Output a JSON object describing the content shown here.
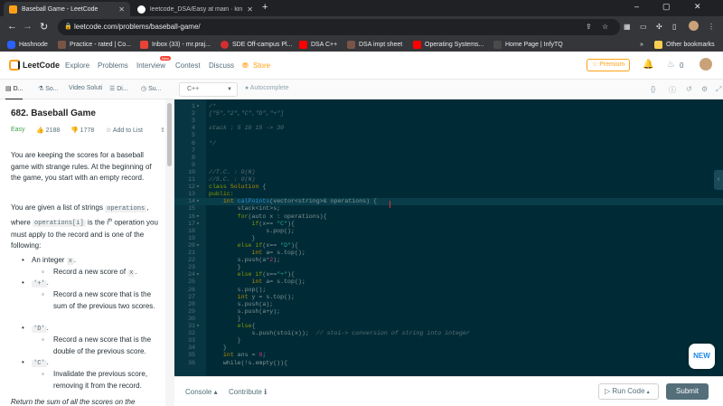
{
  "browser": {
    "tabs": [
      {
        "title": "Baseball Game - LeetCode",
        "active": true
      },
      {
        "title": "leetcode_DSA/Easy at main · kin",
        "active": false
      }
    ],
    "new_tab": "+",
    "window_controls": [
      "–",
      "▢",
      "✕"
    ],
    "url": "leetcode.com/problems/baseball-game/",
    "bookmarks": [
      {
        "label": "Hashnode",
        "color": "#2962ff"
      },
      {
        "label": "Practice - rated | Co...",
        "color": "#795548"
      },
      {
        "label": "Inbox (33) - mr.praj...",
        "color": "#ea4335"
      },
      {
        "label": "SDE Off-campus Pl...",
        "color": "#d32f2f"
      },
      {
        "label": "DSA C++",
        "color": "#ff0000"
      },
      {
        "label": "DSA impt sheet",
        "color": "#795548"
      },
      {
        "label": "Operating Systems...",
        "color": "#ff0000"
      },
      {
        "label": "Home Page | InfyTQ",
        "color": "#4a4a4a"
      }
    ],
    "bookmarks_more": "»",
    "other_bookmarks": "Other bookmarks"
  },
  "lcnav": {
    "logo": "LeetCode",
    "links": [
      "Explore",
      "Problems",
      "Interview",
      "Contest",
      "Discuss",
      "Store"
    ],
    "new_badge": "New",
    "premium": "Premium",
    "notifications_count": "0"
  },
  "left": {
    "tabs": [
      "D...",
      "So...",
      "Video Soluti",
      "Di...",
      "Su..."
    ],
    "title": "682. Baseball Game",
    "difficulty": "Easy",
    "likes": "2188",
    "dislikes": "1778",
    "add_to_list": "Add to List",
    "p1": "You are keeping the scores for a baseball game with strange rules. At the beginning of the game, you start with an empty record.",
    "p2_a": "You are given a list of strings",
    "p2_code1": "operations",
    "p2_b": ", where",
    "p2_code2": "operations[i]",
    "p2_c": "is the",
    "p2_sup": "th",
    "p2_d": "operation you must apply to the record and is one of the following:",
    "items": [
      {
        "head": "An integer",
        "code": "x",
        "desc": "Record a new score of",
        "desc_code": "x"
      },
      {
        "code": "'+'",
        "desc": "Record a new score that is the sum of the previous two scores."
      },
      {
        "code": "'D'",
        "desc": "Record a new score that is the double of the previous score."
      },
      {
        "code": "'C'",
        "desc": "Invalidate the previous score, removing it from the record."
      }
    ],
    "p3": "Return the sum of all the scores on the"
  },
  "editor": {
    "language": "C++",
    "autocomplete": "Autocomplete",
    "lines": [
      {
        "n": "1",
        "fold": "▾",
        "segments": [
          {
            "t": "/*",
            "c": "cm"
          }
        ]
      },
      {
        "n": "2",
        "fold": "",
        "segments": [
          {
            "t": "[\"5\",\"2\",\"C\",\"D\",\"+\"]",
            "c": "cm"
          }
        ]
      },
      {
        "n": "3",
        "fold": "",
        "segments": []
      },
      {
        "n": "4",
        "fold": "",
        "segments": [
          {
            "t": "stack : 5 10 15 -> 30",
            "c": "cm"
          }
        ]
      },
      {
        "n": "5",
        "fold": "",
        "segments": []
      },
      {
        "n": "6",
        "fold": "",
        "segments": [
          {
            "t": "*/",
            "c": "cm"
          }
        ]
      },
      {
        "n": "7",
        "fold": "",
        "segments": []
      },
      {
        "n": "8",
        "fold": "",
        "segments": []
      },
      {
        "n": "9",
        "fold": "",
        "segments": []
      },
      {
        "n": "10",
        "fold": "",
        "segments": [
          {
            "t": "//T.C. : O(N)",
            "c": "cm"
          }
        ]
      },
      {
        "n": "11",
        "fold": "",
        "segments": [
          {
            "t": "//S.C. : O(N)",
            "c": "cm"
          }
        ]
      },
      {
        "n": "12",
        "fold": "▾",
        "segments": [
          {
            "t": "class ",
            "c": "kw"
          },
          {
            "t": "Solution",
            "c": "ty"
          },
          {
            "t": " {",
            "c": "pl"
          }
        ]
      },
      {
        "n": "13",
        "fold": "",
        "segments": [
          {
            "t": "public:",
            "c": "kw"
          }
        ]
      },
      {
        "n": "14",
        "fold": "▾",
        "segments": [
          {
            "t": "    int ",
            "c": "ty"
          },
          {
            "t": "calPoints",
            "c": "fn"
          },
          {
            "t": "(vector<string>& operations) {",
            "c": "pl"
          }
        ]
      },
      {
        "n": "15",
        "fold": "",
        "segments": [
          {
            "t": "        stack<int>s;",
            "c": "pl"
          }
        ]
      },
      {
        "n": "16",
        "fold": "▾",
        "segments": [
          {
            "t": "        for",
            "c": "kw"
          },
          {
            "t": "(auto x : operations){",
            "c": "pl"
          }
        ]
      },
      {
        "n": "17",
        "fold": "▾",
        "segments": [
          {
            "t": "            if",
            "c": "kw"
          },
          {
            "t": "(x== ",
            "c": "pl"
          },
          {
            "t": "\"C\"",
            "c": "st"
          },
          {
            "t": "){",
            "c": "pl"
          }
        ]
      },
      {
        "n": "18",
        "fold": "",
        "segments": [
          {
            "t": "                s.pop();",
            "c": "pl"
          }
        ]
      },
      {
        "n": "19",
        "fold": "",
        "segments": [
          {
            "t": "            }",
            "c": "pl"
          }
        ]
      },
      {
        "n": "20",
        "fold": "▾",
        "segments": [
          {
            "t": "        else if",
            "c": "kw"
          },
          {
            "t": "(x== ",
            "c": "pl"
          },
          {
            "t": "\"D\"",
            "c": "st"
          },
          {
            "t": "){",
            "c": "pl"
          }
        ]
      },
      {
        "n": "21",
        "fold": "",
        "segments": [
          {
            "t": "            int ",
            "c": "ty"
          },
          {
            "t": "a= s.top();",
            "c": "pl"
          }
        ]
      },
      {
        "n": "22",
        "fold": "",
        "segments": [
          {
            "t": "        s.push(a*",
            "c": "pl"
          },
          {
            "t": "2",
            "c": "nm"
          },
          {
            "t": ");",
            "c": "pl"
          }
        ]
      },
      {
        "n": "23",
        "fold": "",
        "segments": [
          {
            "t": "        }",
            "c": "pl"
          }
        ]
      },
      {
        "n": "24",
        "fold": "▾",
        "segments": [
          {
            "t": "        else if",
            "c": "kw"
          },
          {
            "t": "(x==",
            "c": "pl"
          },
          {
            "t": "\"+\"",
            "c": "st"
          },
          {
            "t": "){",
            "c": "pl"
          }
        ]
      },
      {
        "n": "25",
        "fold": "",
        "segments": [
          {
            "t": "            int ",
            "c": "ty"
          },
          {
            "t": "a= s.top();",
            "c": "pl"
          }
        ]
      },
      {
        "n": "26",
        "fold": "",
        "segments": [
          {
            "t": "        s.pop();",
            "c": "pl"
          }
        ]
      },
      {
        "n": "27",
        "fold": "",
        "segments": [
          {
            "t": "        int ",
            "c": "ty"
          },
          {
            "t": "y = s.top();",
            "c": "pl"
          }
        ]
      },
      {
        "n": "28",
        "fold": "",
        "segments": [
          {
            "t": "        s.push(a);",
            "c": "pl"
          }
        ]
      },
      {
        "n": "29",
        "fold": "",
        "segments": [
          {
            "t": "        s.push(a+y);",
            "c": "pl"
          }
        ]
      },
      {
        "n": "30",
        "fold": "",
        "segments": [
          {
            "t": "        }",
            "c": "pl"
          }
        ]
      },
      {
        "n": "31",
        "fold": "▾",
        "segments": [
          {
            "t": "        else",
            "c": "kw"
          },
          {
            "t": "{",
            "c": "pl"
          }
        ]
      },
      {
        "n": "32",
        "fold": "",
        "segments": [
          {
            "t": "            s.push(stoi(x));  ",
            "c": "pl"
          },
          {
            "t": "// stoi-> conversion of string into integer",
            "c": "cm"
          }
        ]
      },
      {
        "n": "33",
        "fold": "",
        "segments": [
          {
            "t": "        }",
            "c": "pl"
          }
        ]
      },
      {
        "n": "34",
        "fold": "",
        "segments": [
          {
            "t": "    }",
            "c": "pl"
          }
        ]
      },
      {
        "n": "35",
        "fold": "",
        "segments": [
          {
            "t": "    int ",
            "c": "ty"
          },
          {
            "t": "ans = ",
            "c": "pl"
          },
          {
            "t": "0",
            "c": "nm"
          },
          {
            "t": ";",
            "c": "pl"
          }
        ]
      },
      {
        "n": "36",
        "fold": "",
        "segments": [
          {
            "t": "    while(!s.empty()){",
            "c": "pl"
          }
        ]
      }
    ]
  },
  "bottom": {
    "console": "Console",
    "contribute": "Contribute",
    "run": "Run Code",
    "submit": "Submit",
    "new_float": "NEW"
  }
}
